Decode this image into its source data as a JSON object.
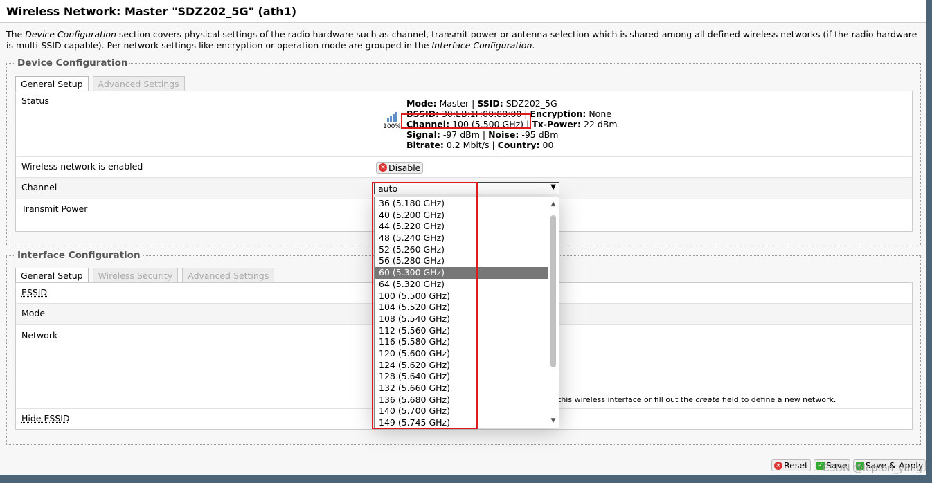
{
  "page_title": "Wireless Network: Master \"SDZ202_5G\" (ath1)",
  "description": {
    "part1": "The ",
    "em1": "Device Configuration",
    "part2": " section covers physical settings of the radio hardware such as channel, transmit power or antenna selection which is shared among all defined wireless networks (if the radio hardware is multi-SSID capable). Per network settings like encryption or operation mode are grouped in the ",
    "em2": "Interface Configuration",
    "part3": "."
  },
  "device_config": {
    "legend": "Device Configuration",
    "tabs": [
      "General Setup",
      "Advanced Settings"
    ],
    "status_label": "Status",
    "signal_percent": "100%",
    "signal_icon": "signal-strength-icon",
    "status": {
      "mode_label": "Mode:",
      "mode": "Master",
      "ssid_label": "SSID:",
      "ssid": "SDZ202_5G",
      "bssid_label": "BSSID:",
      "bssid": "30:EB:1F:00:88:00",
      "encryption_label": "Encryption:",
      "encryption": "None",
      "channel_label": "Channel:",
      "channel": "100 (5.500 GHz)",
      "txpower_label": "Tx-Power:",
      "txpower": "22 dBm",
      "signal_label": "Signal:",
      "signal": "-97 dBm",
      "noise_label": "Noise:",
      "noise": "-95 dBm",
      "bitrate_label": "Bitrate:",
      "bitrate": "0.2 Mbit/s",
      "country_label": "Country:",
      "country": "00"
    },
    "enabled_label": "Wireless network is enabled",
    "disable_button": "Disable",
    "channel_label": "Channel",
    "channel_value": "auto",
    "txpower_row_label": "Transmit Power"
  },
  "channel_options": [
    "36 (5.180 GHz)",
    "40 (5.200 GHz)",
    "44 (5.220 GHz)",
    "48 (5.240 GHz)",
    "52 (5.260 GHz)",
    "56 (5.280 GHz)",
    "60 (5.300 GHz)",
    "64 (5.320 GHz)",
    "100 (5.500 GHz)",
    "104 (5.520 GHz)",
    "108 (5.540 GHz)",
    "112 (5.560 GHz)",
    "116 (5.580 GHz)",
    "120 (5.600 GHz)",
    "124 (5.620 GHz)",
    "128 (5.640 GHz)",
    "132 (5.660 GHz)",
    "136 (5.680 GHz)",
    "140 (5.700 GHz)",
    "149 (5.745 GHz)"
  ],
  "highlighted_option": "60 (5.300 GHz)",
  "interface_config": {
    "legend": "Interface Configuration",
    "tabs": [
      "General Setup",
      "Wireless Security",
      "Advanced Settings"
    ],
    "essid_label": "ESSID",
    "mode_label": "Mode",
    "network_label": "Network",
    "network_help_pre": "this wireless interface or fill out the ",
    "network_help_em": "create",
    "network_help_post": " field to define a new network.",
    "hide_essid_label": "Hide ESSID"
  },
  "actions": {
    "reset": "Reset",
    "save": "Save",
    "save_apply": "Save & Apply"
  },
  "watermark": "CSDN @lepton_yang",
  "colors": {
    "highlight_box": "#e01b1b",
    "selected_option_bg": "#777777"
  }
}
